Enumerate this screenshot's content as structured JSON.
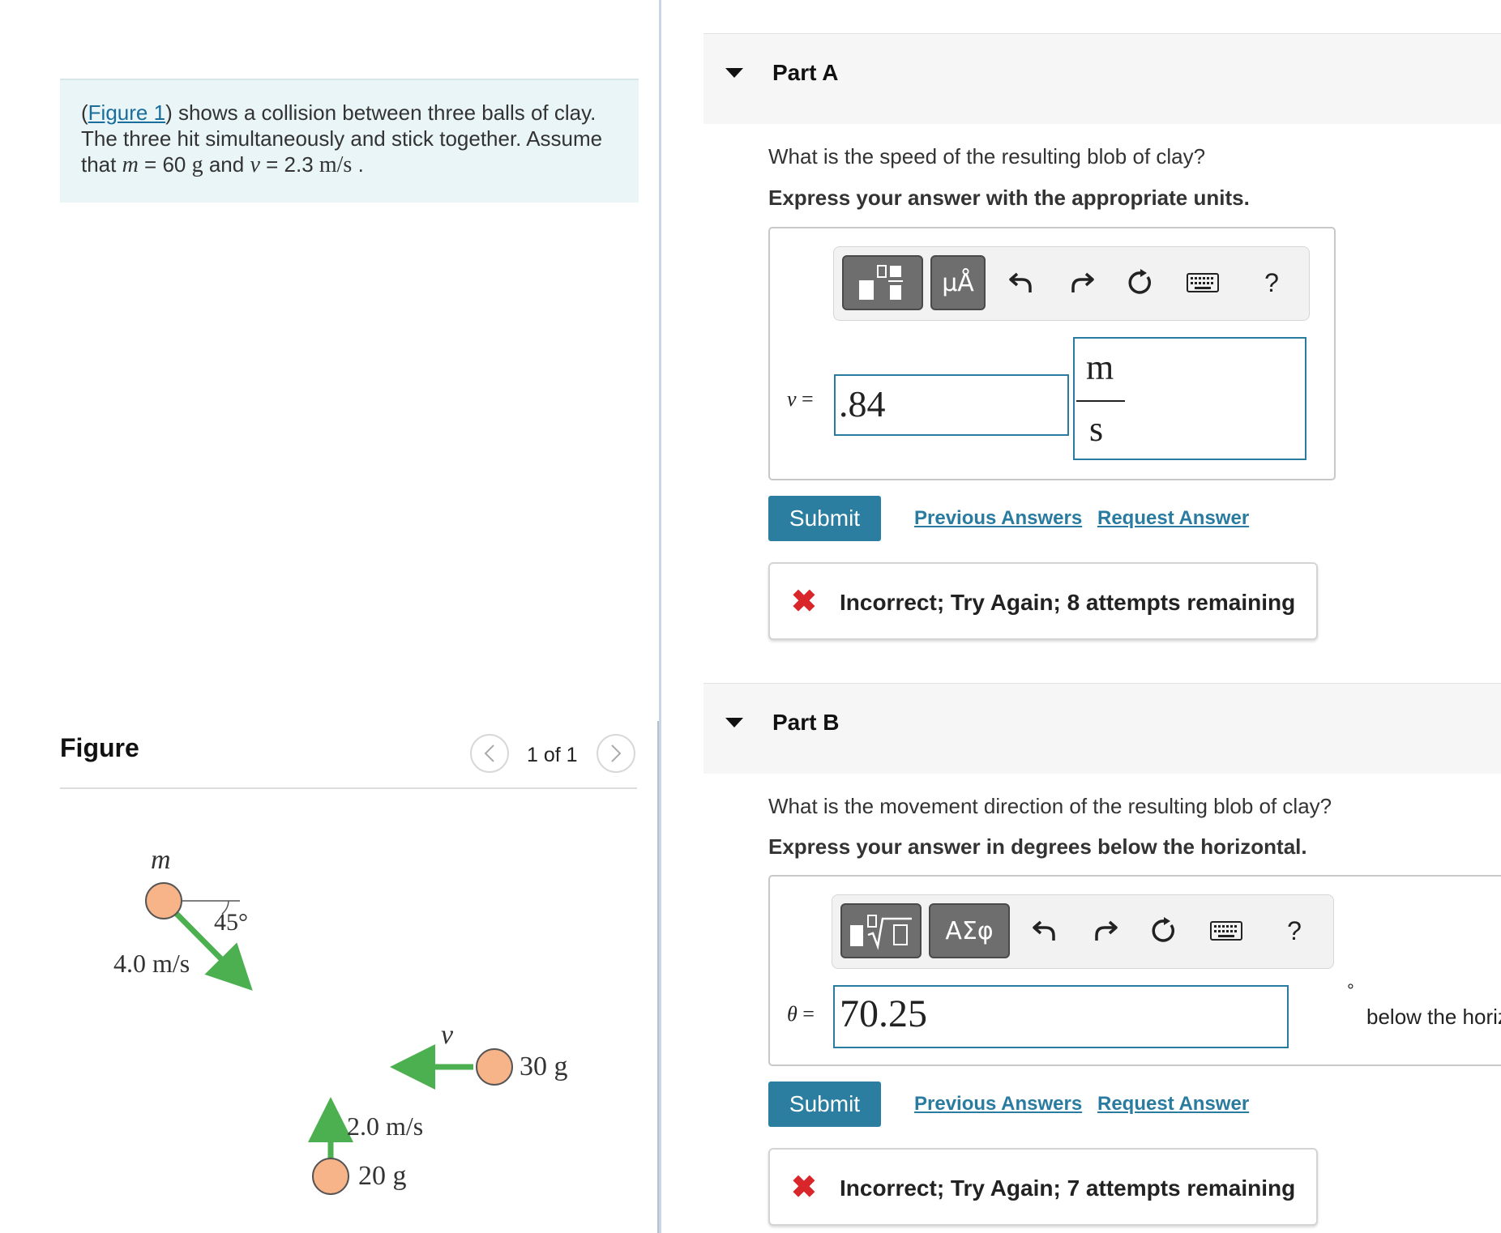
{
  "problem": {
    "link_text": "Figure 1",
    "open_paren": "(",
    "text_1": ") shows a collision between three balls of clay. The three hit simultaneously and stick together. Assume that ",
    "m_var": "m",
    "m_eq": " = 60 ",
    "m_unit": "g",
    "and": " and ",
    "v_var": "v",
    "v_eq": " = 2.3 ",
    "v_unit": "m/s",
    "end": " ."
  },
  "figure": {
    "heading": "Figure",
    "counter": "1 of 1",
    "prev_icon": "chevron-left-icon",
    "next_icon": "chevron-right-icon",
    "labels": {
      "m": "m",
      "angle": "45°",
      "speed_m": "4.0 m/s",
      "v": "v",
      "mass_30": "30 g",
      "speed_20": "2.0 m/s",
      "mass_20": "20 g"
    },
    "colors": {
      "ball": "#f7b488",
      "arrow": "#4caf50"
    }
  },
  "partA": {
    "title": "Part A",
    "question": "What is the speed of the resulting blob of clay?",
    "instruction": "Express your answer with the appropriate units.",
    "toolbar": {
      "units_button": "μÅ",
      "help": "?"
    },
    "var_label": "v",
    "equals": " =",
    "value": ".84",
    "unit_numerator": "m",
    "unit_denominator": "s",
    "submit": "Submit",
    "previous_answers": "Previous Answers",
    "request_answer": "Request Answer",
    "feedback": "Incorrect; Try Again; 8 attempts remaining"
  },
  "partB": {
    "title": "Part B",
    "question": "What is the movement direction of the resulting blob of clay?",
    "instruction": "Express your answer in degrees below the horizontal.",
    "toolbar": {
      "greek_button": "ΑΣφ",
      "help": "?"
    },
    "var_label": "θ",
    "equals": " =",
    "value": "70.25",
    "degree": "°",
    "suffix": "below the horizontal",
    "submit": "Submit",
    "previous_answers": "Previous Answers",
    "request_answer": "Request Answer",
    "feedback": "Incorrect; Try Again; 7 attempts remaining"
  },
  "colors": {
    "accent": "#2b7ea0",
    "error": "#d9262b",
    "problem_bg": "#eaf5f7"
  }
}
